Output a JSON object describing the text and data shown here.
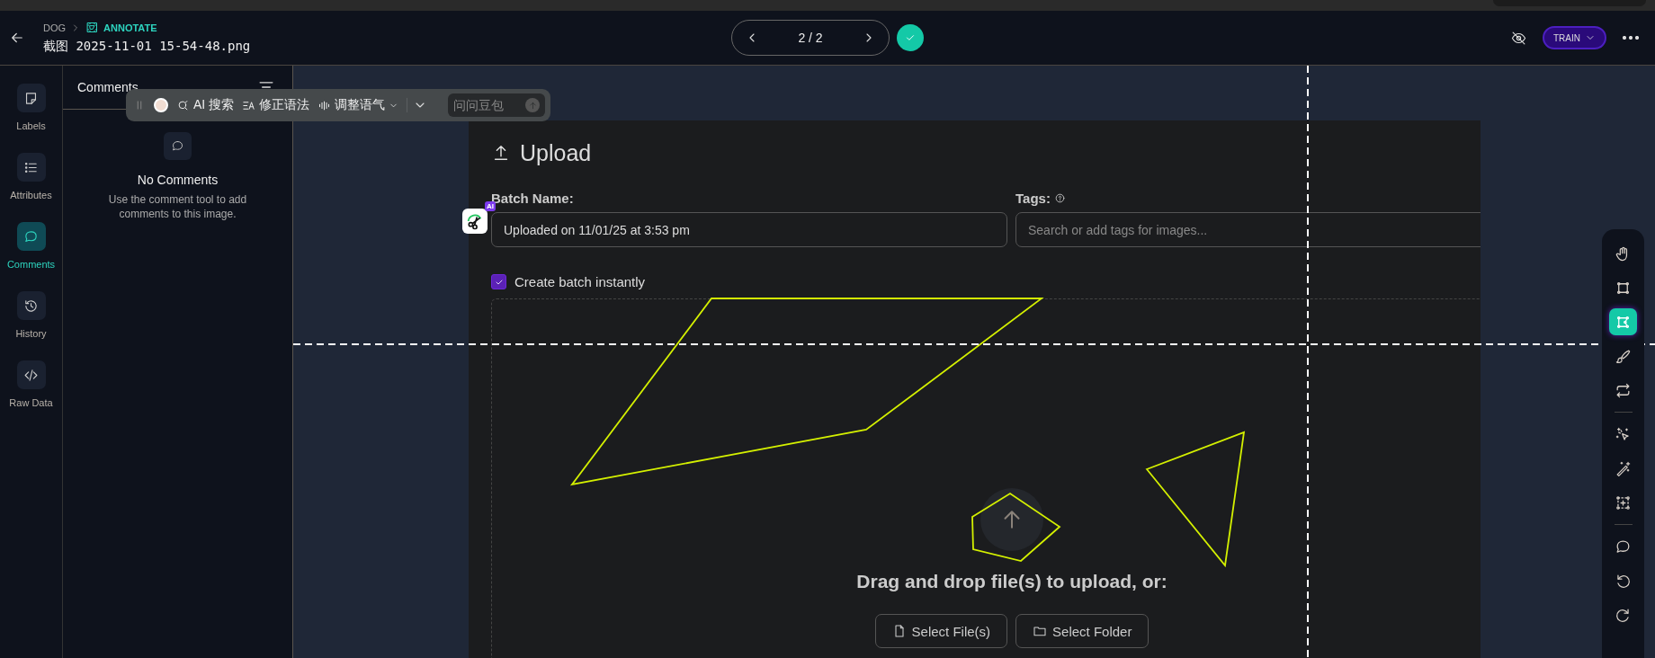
{
  "header": {
    "project": "DOG",
    "mode": "ANNOTATE",
    "filename": "截图 2025-11-01 15-54-48.png",
    "pager": "2 / 2",
    "train_button": "TRAIN"
  },
  "rail": [
    {
      "kind": "labels",
      "label": "Labels",
      "selected": false
    },
    {
      "kind": "attributes",
      "label": "Attributes",
      "selected": false
    },
    {
      "kind": "comments",
      "label": "Comments",
      "selected": true
    },
    {
      "kind": "history",
      "label": "History",
      "selected": false
    },
    {
      "kind": "raw",
      "label": "Raw Data",
      "selected": false
    }
  ],
  "comments_panel": {
    "title": "Comments",
    "empty_title": "No Comments",
    "empty_text": "Use the comment tool to add comments to this image."
  },
  "floating_toolbar": {
    "actions": [
      {
        "kind": "search",
        "label": "AI 搜索"
      },
      {
        "kind": "grammar",
        "label": "修正语法"
      },
      {
        "kind": "tone",
        "label": "调整语气"
      }
    ],
    "ask_placeholder": "问问豆包"
  },
  "ai_badge": "AI",
  "upload": {
    "title": "Upload",
    "batch_label": "Batch Name:",
    "batch_value": "Uploaded on 11/01/25 at 3:53 pm",
    "tags_label": "Tags:",
    "tags_placeholder": "Search or add tags for images...",
    "create_instantly": {
      "label": "Create batch instantly",
      "checked": true
    },
    "drop_text": "Drag and drop file(s) to upload, or:",
    "buttons": [
      {
        "kind": "file",
        "label": "Select File(s)"
      },
      {
        "kind": "folder",
        "label": "Select Folder"
      }
    ]
  },
  "tools": [
    {
      "kind": "hand",
      "selected": false
    },
    {
      "kind": "box",
      "selected": false
    },
    {
      "kind": "polygon",
      "selected": true
    },
    {
      "kind": "brush",
      "selected": false
    },
    {
      "kind": "convert",
      "selected": false
    },
    {
      "kind": "divider"
    },
    {
      "kind": "smart-select",
      "selected": false
    },
    {
      "kind": "wand",
      "selected": false
    },
    {
      "kind": "auto-box",
      "selected": false
    },
    {
      "kind": "divider"
    },
    {
      "kind": "comment",
      "selected": false
    },
    {
      "kind": "undo",
      "selected": false
    },
    {
      "kind": "redo",
      "selected": false
    }
  ]
}
